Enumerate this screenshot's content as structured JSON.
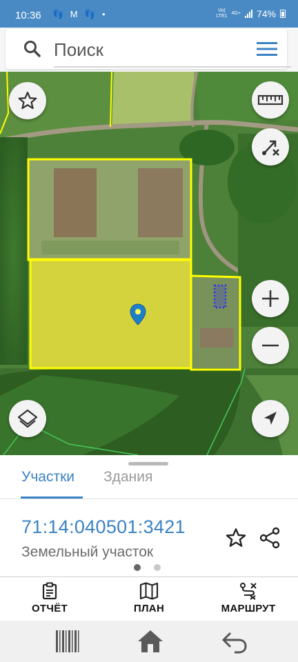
{
  "status_bar": {
    "time": "10:36",
    "left_icons": "👣 M 👣 •",
    "network_top": "Vo)",
    "network_mid": "4G+",
    "network_bottom": "LTE1",
    "battery": "74%"
  },
  "search": {
    "placeholder": "Поиск"
  },
  "tabs": {
    "active": "Участки",
    "inactive": "Здания"
  },
  "parcel": {
    "cadastral_number": "71:14:040501:3421",
    "type": "Земельный участок"
  },
  "actions": {
    "report": "ОТЧЁТ",
    "plan": "ПЛАН",
    "route": "МАРШРУТ"
  },
  "colors": {
    "accent": "#3a82c4",
    "status_bar": "#4a8ac4",
    "parcel_outline": "#ffff00",
    "marker": "#1e7fc8"
  },
  "icons": [
    "search-icon",
    "menu-icon",
    "star-icon",
    "ruler-icon",
    "route-clear-icon",
    "zoom-in-icon",
    "zoom-out-icon",
    "layers-icon",
    "locate-icon",
    "map-marker-icon",
    "share-icon",
    "report-icon",
    "map-plan-icon",
    "route-icon",
    "barcode-icon",
    "home-icon",
    "back-icon"
  ]
}
